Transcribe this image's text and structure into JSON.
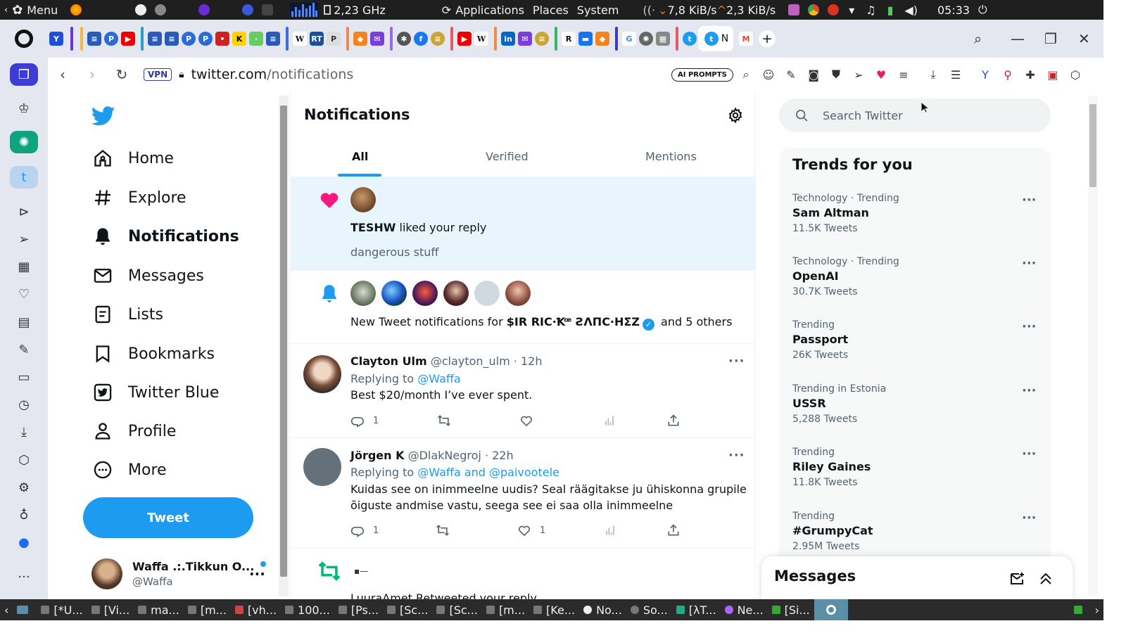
{
  "os_panel": {
    "menu_label": "Menu",
    "cpu_freq": "2,23 GHz",
    "applications_label": "Applications",
    "places_label": "Places",
    "system_label": "System",
    "net_down": "7,8 KiB/s",
    "net_up": "2,3 KiB/s",
    "clock": "05:33"
  },
  "browser": {
    "url_host": "twitter.com",
    "url_path": "/notifications",
    "vpn_label": "VPN",
    "ai_prompts_label": "AI PROMPTS",
    "active_tab_label": "N"
  },
  "twitter_nav": {
    "items": [
      {
        "label": "Home",
        "icon": "home-icon"
      },
      {
        "label": "Explore",
        "icon": "hashtag-icon"
      },
      {
        "label": "Notifications",
        "icon": "bell-icon"
      },
      {
        "label": "Messages",
        "icon": "envelope-icon"
      },
      {
        "label": "Lists",
        "icon": "list-icon"
      },
      {
        "label": "Bookmarks",
        "icon": "bookmark-icon"
      },
      {
        "label": "Twitter Blue",
        "icon": "twitter-blue-icon"
      },
      {
        "label": "Profile",
        "icon": "person-icon"
      },
      {
        "label": "More",
        "icon": "more-circle-icon"
      }
    ],
    "tweet_button": "Tweet",
    "account_name": "Waffa .:.Tikkun O...",
    "account_handle": "@Waffa"
  },
  "feed": {
    "title": "Notifications",
    "tabs": [
      "All",
      "Verified",
      "Mentions"
    ],
    "like_notification": {
      "user": "TESHW",
      "action": " liked your reply",
      "snippet": "dangerous stuff"
    },
    "tweet_notification": {
      "prefix": "New Tweet notifications for ",
      "user": "$IR RIC·Ꝁꟹ ƧΛΠC·HΣZ",
      "suffix": " and 5 others"
    },
    "tweets": [
      {
        "name": "Clayton Ulm",
        "meta": "@clayton_ulm · 12h",
        "replying_prefix": "Replying to ",
        "replying_to": "@Waffa",
        "text": "Best $20/month I’ve ever spent.",
        "replies": "1",
        "retweets": "",
        "likes": ""
      },
      {
        "name": "Jörgen K",
        "meta": "@DlakNegroj · 22h",
        "replying_prefix": "Replying to ",
        "replying_to": "@Waffa and @paivootele",
        "text_line1": "Kuidas see on inimmeelne uudis? Seal räägitakse ju ühiskonna grupile",
        "text_line2": "õiguste andmise vastu, seega see ei saa olla inimmeelne",
        "replies": "1",
        "retweets": "",
        "likes": "1"
      }
    ],
    "retweet_partial": "LuuraAmet Retweeted your reply"
  },
  "search": {
    "placeholder": "Search Twitter"
  },
  "trends": {
    "title": "Trends for you",
    "items": [
      {
        "context": "Technology · Trending",
        "name": "Sam Altman",
        "count": "11.5K Tweets"
      },
      {
        "context": "Technology · Trending",
        "name": "OpenAI",
        "count": "30.7K Tweets"
      },
      {
        "context": "Trending",
        "name": "Passport",
        "count": "26K Tweets"
      },
      {
        "context": "Trending in Estonia",
        "name": "USSR",
        "count": "5,288 Tweets"
      },
      {
        "context": "Trending",
        "name": "Riley Gaines",
        "count": "11.8K Tweets"
      },
      {
        "context": "Trending",
        "name": "#GrumpyCat",
        "count": "2.95M Tweets"
      }
    ]
  },
  "messages_drawer": {
    "title": "Messages"
  },
  "taskbar": {
    "items": [
      "[*U...",
      "[Vi...",
      "ma...",
      "[m...",
      "[vh...",
      "100...",
      "[Ps...",
      "[Sc...",
      "[Sc...",
      "[m...",
      "[Ke...",
      "No...",
      "So...",
      "[λT...",
      "Ne...",
      "[Si..."
    ]
  },
  "colors": {
    "twitter_blue": "#1d9bf0",
    "like_pink": "#f91880",
    "retweet_green": "#00ba7c",
    "highlight_bg": "#e8f5fd",
    "opera_chrome": "#e4e6f0"
  }
}
